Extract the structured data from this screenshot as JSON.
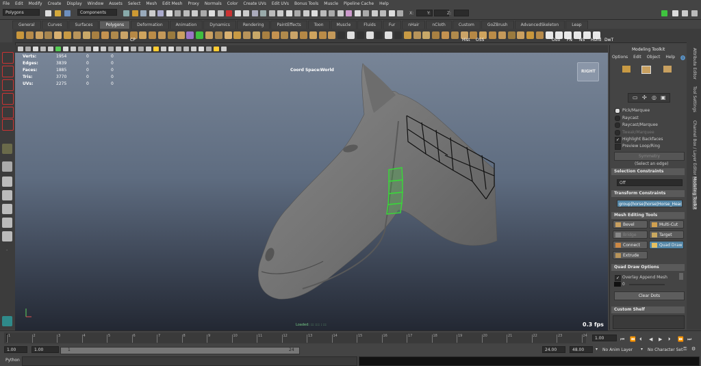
{
  "menubar": [
    "File",
    "Edit",
    "Modify",
    "Create",
    "Display",
    "Window",
    "Assets",
    "Select",
    "Mesh",
    "Edit Mesh",
    "Proxy",
    "Normals",
    "Color",
    "Create UVs",
    "Edit UVs",
    "Bonus Tools",
    "Muscle",
    "Pipeline Cache",
    "Help"
  ],
  "statusline": {
    "menu_set": "Polygons",
    "selection_mode": "Components",
    "x_label": "X:",
    "y_label": "Y:",
    "z_label": "Z:"
  },
  "shelf_tabs": [
    "General",
    "Curves",
    "Surfaces",
    "Polygons",
    "Deformation",
    "Animation",
    "Dynamics",
    "Rendering",
    "PaintEffects",
    "Toon",
    "Muscle",
    "Fluids",
    "Fur",
    "nHair",
    "nCloth",
    "Custom",
    "GoZBrush",
    "AdvancedSkeleton",
    "Leap"
  ],
  "shelf_active_tab": "Polygons",
  "shelf_labels": {
    "cp": "CP",
    "hist": "Hist",
    "oss": "OSS",
    "outl": "Outl",
    "fn": "FN",
    "ns": "NS",
    "hshd": "Hshd",
    "dwt": "DwT"
  },
  "hud": {
    "rows": [
      {
        "label": "Verts:",
        "v1": "1954",
        "v2": "0",
        "v3": "0"
      },
      {
        "label": "Edges:",
        "v1": "3839",
        "v2": "0",
        "v3": "0"
      },
      {
        "label": "Faces:",
        "v1": "1885",
        "v2": "0",
        "v3": "0"
      },
      {
        "label": "Tris:",
        "v1": "3770",
        "v2": "0",
        "v3": "0"
      },
      {
        "label": "UVs:",
        "v1": "2275",
        "v2": "0",
        "v3": "0"
      }
    ],
    "coord_label": "Coord Space:",
    "coord_value": "World",
    "fps": "0.3 fps",
    "viewcube": "RIGHT",
    "bottom_text": "Loaded: ::: :::: : :::"
  },
  "toolkit": {
    "title": "Modeling Toolkit",
    "menu": [
      "Options",
      "Edit",
      "Object",
      "Help"
    ],
    "pick_options": [
      {
        "label": "Pick/Marquee",
        "on": true
      },
      {
        "label": "Raycast",
        "on": false
      },
      {
        "label": "Raycast/Marquee",
        "on": false
      },
      {
        "label": "Tweak/Marquee",
        "on": false
      }
    ],
    "highlight_backfaces": "Highlight Backfaces",
    "preview_loop": "Preview Loop/Ring",
    "symmetry": "Symmetry",
    "select_hint": "(Select an edge)",
    "selection_constraints": "Selection Constraints",
    "constraint_value": "Off",
    "transform_constraints": "Transform Constraints",
    "object_name": "group|horse|horse|Horse_Head",
    "mesh_editing_tools": "Mesh Editing Tools",
    "tools": [
      {
        "label": "Bevel",
        "selected": false
      },
      {
        "label": "Multi-Cut",
        "selected": false
      },
      {
        "label": "Bridge",
        "selected": false
      },
      {
        "label": "Target Weld",
        "selected": false
      },
      {
        "label": "Connect",
        "selected": false
      },
      {
        "label": "Quad Draw",
        "selected": true
      },
      {
        "label": "Extrude",
        "selected": false
      }
    ],
    "quad_draw_options": "Quad Draw Options",
    "overlay_append": "Overlay Append Mesh",
    "overlay_value": "0",
    "clear_dots": "Clear Dots",
    "custom_shelf": "Custom Shelf"
  },
  "vtabs": [
    "Attribute Editor",
    "Tool Settings",
    "Channel Box / Layer Editor",
    "Modeling Toolkit"
  ],
  "timeline": {
    "ticks": [
      "1",
      "2",
      "3",
      "4",
      "5",
      "6",
      "7",
      "8",
      "9",
      "10",
      "11",
      "12",
      "13",
      "14",
      "15",
      "16",
      "17",
      "18",
      "19",
      "20",
      "21",
      "22",
      "23",
      "24"
    ],
    "current_frame": "1.00",
    "playback_buttons": [
      "⏮",
      "⏪",
      "⏴",
      "◀",
      "▶",
      "⏵",
      "⏩",
      "⏭"
    ]
  },
  "range": {
    "start": "1.00",
    "start2": "1.00",
    "slider_start": "1",
    "slider_end": "24",
    "end": "24.00",
    "end2": "48.00",
    "anim_layer": "No Anim Layer",
    "character_set": "No Character Set"
  },
  "command": {
    "language": "Python"
  },
  "colors": {
    "accent": "#5285a6",
    "quad_green": "#39d839",
    "viewport_top": "#788597",
    "viewport_bottom": "#232833"
  }
}
